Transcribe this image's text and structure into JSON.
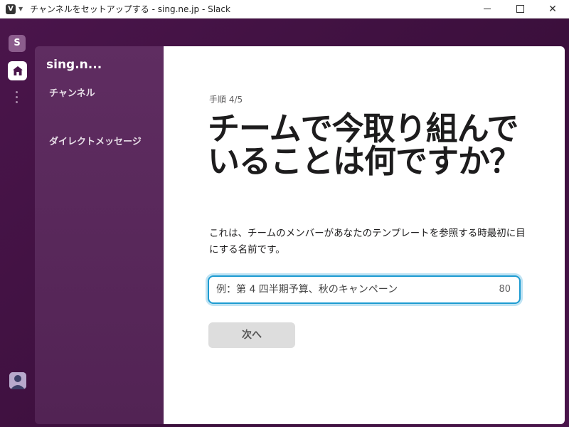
{
  "window": {
    "title": "チャンネルをセットアップする - sing.ne.jp - Slack",
    "app_icon_letter": "V"
  },
  "rail": {
    "workspace_initial": "S"
  },
  "sidebar": {
    "workspace_name": "sing.n...",
    "channels_label": "チャンネル",
    "dm_label": "ダイレクトメッセージ"
  },
  "main": {
    "step": "手順 4/5",
    "heading": "チームで今取り組んでいることは何ですか？",
    "description": "これは、チームのメンバーがあなたのテンプレートを参照する時最初に目にする名前です。",
    "input_placeholder": "例：第 4 四半期予算、秋のキャンペーン",
    "char_limit": "80",
    "next_label": "次へ"
  },
  "colors": {
    "aubergine": "#4a154b",
    "sidebar": "#5d2b5f",
    "focus_blue": "#1d9bd1"
  }
}
